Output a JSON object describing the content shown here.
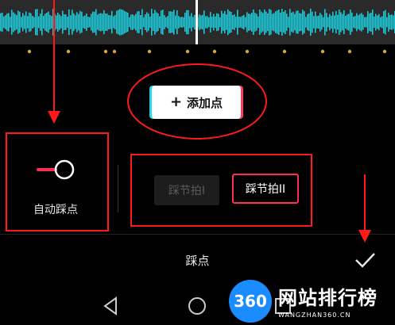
{
  "colors": {
    "waveform": "#1ec8d6",
    "beat_dot": "#e0a33a",
    "accent": "#ff2d55",
    "annotation": "#ff1a1a"
  },
  "add_point": {
    "label": "添加点",
    "icon": "plus-icon"
  },
  "auto_beat": {
    "label": "自动踩点",
    "enabled": false
  },
  "beat_options": [
    {
      "label": "踩节拍I",
      "selected": false
    },
    {
      "label": "踩节拍II",
      "selected": true
    }
  ],
  "panel": {
    "title": "踩点",
    "confirm_icon": "check-icon"
  },
  "nav": {
    "back_icon": "triangle-back-icon",
    "home_icon": "circle-home-icon",
    "recents_icon": "square-recents-icon"
  },
  "watermark": {
    "logo": "360",
    "text": "网站排行榜",
    "sub": "WANGZHAN360.CN"
  }
}
